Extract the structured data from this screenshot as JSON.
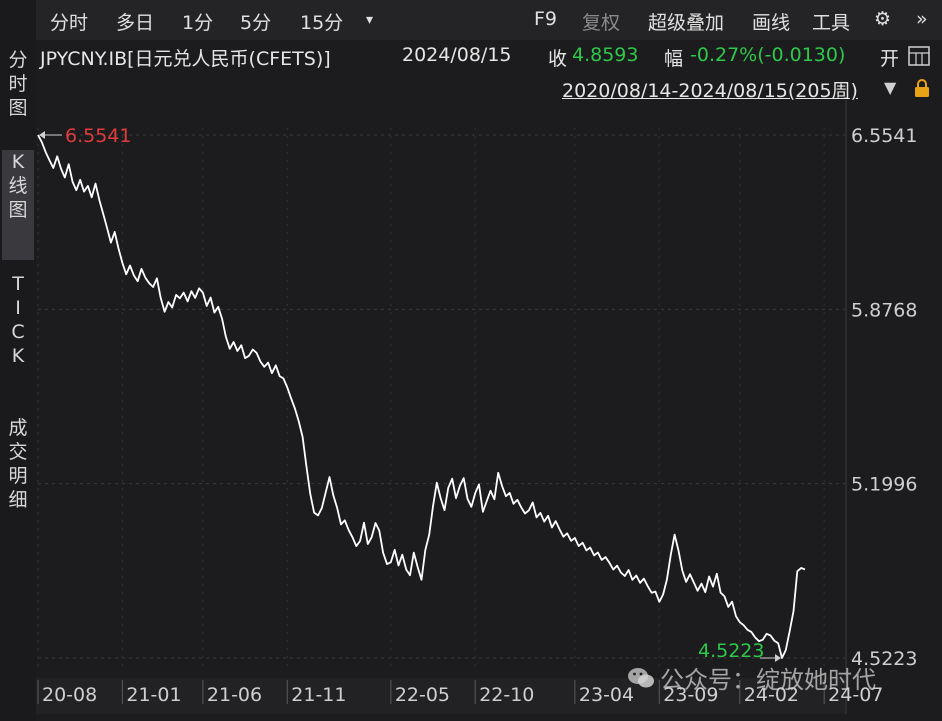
{
  "toolbar": {
    "items": [
      "分时",
      "多日",
      "1分",
      "5分",
      "15分",
      "▾"
    ],
    "right_items": [
      "F9",
      "复权",
      "超级叠加",
      "画线",
      "工具",
      "⚙",
      "»"
    ]
  },
  "info": {
    "symbol": "JPYCNY.IB[日元兑人民币(CFETS)]",
    "date": "2024/08/15",
    "close_label": "收",
    "close_value": "4.8593",
    "change_label": "幅",
    "change_value": "-0.27%(-0.0130)",
    "open_label": "开",
    "open_icon": "grid-icon",
    "range": "2020/08/14-2024/08/15(205周)",
    "range_arrow": "▼",
    "lock_icon": "lock-icon"
  },
  "leftnav": {
    "tabs": [
      {
        "label": [
          "分",
          "时",
          "图"
        ],
        "active": false
      },
      {
        "label": [
          "K",
          "线",
          "图"
        ],
        "active": true
      },
      {
        "label": [
          "T",
          "I",
          "C",
          "K"
        ],
        "active": false
      },
      {
        "label": [
          "成",
          "交",
          "明",
          "细"
        ],
        "active": false
      }
    ]
  },
  "watermark": "公众号：绽放她时代",
  "colors": {
    "background": "#1c1c1e",
    "line": "#ffffff",
    "max_label": "#e03c3c",
    "min_label": "#2ec84a",
    "down": "#2ec84a"
  },
  "chart_data": {
    "type": "line",
    "title": "",
    "xlabel": "",
    "ylabel": "",
    "y_ticks": [
      "6.5541",
      "5.8768",
      "5.1996",
      "4.5223"
    ],
    "y_tick_values": [
      6.5541,
      5.8768,
      5.1996,
      4.5223
    ],
    "ylim": [
      4.5223,
      6.5541
    ],
    "x_ticks": [
      "20-08",
      "21-01",
      "21-06",
      "21-11",
      "22-05",
      "22-10",
      "23-04",
      "23-09",
      "24-02",
      "24-07"
    ],
    "x_tick_index": [
      0,
      22,
      43,
      65,
      92,
      114,
      140,
      162,
      183,
      205
    ],
    "max_label": "6.5541",
    "min_label": "4.5223",
    "grid": true,
    "series": [
      {
        "values": [
          6.5541,
          6.5267,
          6.4872,
          6.4563,
          6.4258,
          6.4712,
          6.4234,
          6.3891,
          6.4408,
          6.3732,
          6.3398,
          6.3802,
          6.3341,
          6.3563,
          6.3121,
          6.3654,
          6.3009,
          6.2478,
          6.1941,
          6.1362,
          6.1778,
          6.1133,
          6.0572,
          6.0129,
          6.0473,
          6.0081,
          5.9863,
          6.0342,
          5.9992,
          5.9784,
          5.9637,
          5.9973,
          5.9214,
          5.8672,
          5.9052,
          5.8838,
          5.9328,
          5.9197,
          5.9418,
          5.9078,
          5.9473,
          5.9212,
          5.9584,
          5.9418,
          5.8896,
          5.9229,
          5.8642,
          5.8867,
          5.8397,
          5.7698,
          5.7237,
          5.7498,
          5.7149,
          5.7376,
          5.6873,
          5.6962,
          5.7208,
          5.7076,
          5.6742,
          5.6536,
          5.6698,
          5.6289,
          5.6596,
          5.6173,
          5.6087,
          5.5731,
          5.5312,
          5.4917,
          5.4412,
          5.3812,
          5.2673,
          5.1589,
          5.0873,
          5.0762,
          5.1043,
          5.1641,
          5.2249,
          5.1542,
          5.1061,
          5.0412,
          5.0573,
          5.0201,
          4.9913,
          4.9571,
          4.9768,
          5.0478,
          4.9653,
          4.9913,
          5.0467,
          5.0173,
          4.9312,
          4.8872,
          4.8941,
          4.9428,
          4.8817,
          4.9238,
          4.8661,
          4.8438,
          4.9317,
          4.8749,
          4.8262,
          4.9412,
          5.0013,
          5.1116,
          5.2034,
          5.1423,
          5.0967,
          5.1838,
          5.2189,
          5.1432,
          5.1911,
          5.2213,
          5.1409,
          5.1098,
          5.1624,
          5.1968,
          5.0902,
          5.1314,
          5.1721,
          5.1389,
          5.2419,
          5.1912,
          5.1509,
          5.1637,
          5.1214,
          5.1367,
          5.1079,
          5.0838,
          5.0962,
          5.1267,
          5.0687,
          5.0864,
          5.0521,
          5.0748,
          5.0291,
          5.0543,
          5.0218,
          4.9934,
          5.0067,
          4.9776,
          4.9883,
          4.9572,
          4.9702,
          4.9402,
          4.9512,
          4.9209,
          4.9323,
          4.9034,
          4.9143,
          4.8921,
          4.8663,
          4.8811,
          4.8546,
          4.8408,
          4.8643,
          4.8262,
          4.8427,
          4.8139,
          4.8308,
          4.8009,
          4.7761,
          4.7802,
          4.7408,
          4.7689,
          4.8267,
          4.9238,
          5.0018,
          4.9413,
          4.8623,
          4.8178,
          4.8479,
          4.8158,
          4.7833,
          4.8112,
          4.7779,
          4.8389,
          4.7998,
          4.8493,
          4.7762,
          4.7617,
          4.7208,
          4.7412,
          4.6843,
          4.6612,
          4.6497,
          4.6318,
          4.6237,
          4.6024,
          4.5876,
          4.5933,
          4.6163,
          4.6097,
          4.5897,
          4.5793,
          4.5223,
          4.5532,
          4.6273,
          4.7042,
          4.8593,
          4.8723,
          4.8662
        ]
      }
    ]
  }
}
